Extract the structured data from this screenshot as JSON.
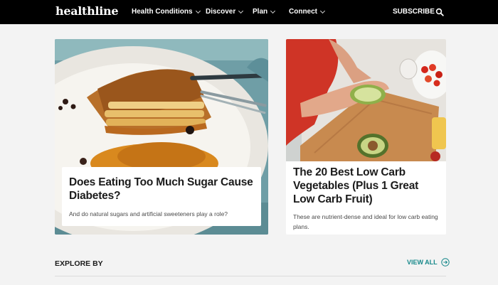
{
  "nav": {
    "logo": "healthline",
    "items": [
      {
        "label": "Health Conditions"
      },
      {
        "label": "Discover"
      },
      {
        "label": "Plan"
      },
      {
        "label": "Connect"
      }
    ],
    "subscribe": "SUBSCRIBE",
    "search_icon": "search-icon"
  },
  "cards": [
    {
      "title": "Does Eating Too Much Sugar Cause Diabetes?",
      "subtitle": "And do natural sugars and artificial sweeteners play a role?"
    },
    {
      "title": "The 20 Best Low Carb Vegetables (Plus 1 Great Low Carb Fruit)",
      "subtitle": "These are nutrient-dense and ideal for low carb eating plans."
    }
  ],
  "explore": {
    "heading": "EXPLORE BY",
    "view_all": "VIEW ALL",
    "view_all_icon": "arrow-circle-right-icon"
  },
  "colors": {
    "nav_bg": "#000000",
    "page_bg": "#f3f3f3",
    "accent": "#16888a"
  }
}
